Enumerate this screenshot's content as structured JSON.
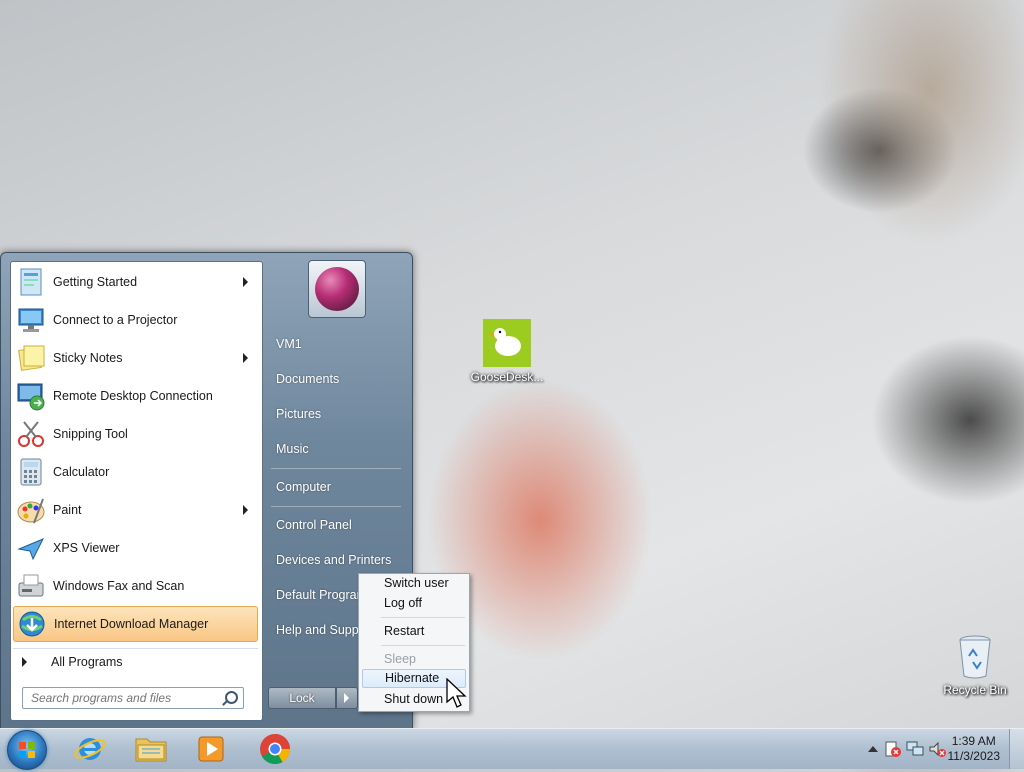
{
  "desktop": {
    "icons": [
      {
        "label": "GooseDesk..."
      },
      {
        "label": "Recycle Bin"
      }
    ]
  },
  "start_menu": {
    "programs": [
      {
        "label": "Getting Started",
        "submenu": true
      },
      {
        "label": "Connect to a Projector",
        "submenu": false
      },
      {
        "label": "Sticky Notes",
        "submenu": true
      },
      {
        "label": "Remote Desktop Connection",
        "submenu": false
      },
      {
        "label": "Snipping Tool",
        "submenu": false
      },
      {
        "label": "Calculator",
        "submenu": false
      },
      {
        "label": "Paint",
        "submenu": true
      },
      {
        "label": "XPS Viewer",
        "submenu": false
      },
      {
        "label": "Windows Fax and Scan",
        "submenu": false
      },
      {
        "label": "Internet Download Manager",
        "submenu": false,
        "highlighted": true
      }
    ],
    "all_programs": "All Programs",
    "search_placeholder": "Search programs and files",
    "right_items": {
      "user": "VM1",
      "documents": "Documents",
      "pictures": "Pictures",
      "music": "Music",
      "computer": "Computer",
      "control_panel": "Control Panel",
      "devices": "Devices and Printers",
      "default_programs": "Default Programs",
      "help": "Help and Support"
    },
    "lock_label": "Lock"
  },
  "power_menu": {
    "switch_user": "Switch user",
    "log_off": "Log off",
    "restart": "Restart",
    "sleep": "Sleep",
    "hibernate": "Hibernate",
    "shut_down": "Shut down"
  },
  "taskbar": {
    "pinned": [
      "internet-explorer-icon",
      "file-explorer-icon",
      "media-player-icon",
      "chrome-icon"
    ],
    "clock_time": "1:39 AM",
    "clock_date": "11/3/2023"
  },
  "colors": {
    "highlight": "#f9c684",
    "start_menu_bg": "#6f879d",
    "taskbar": "#aebfd0"
  }
}
